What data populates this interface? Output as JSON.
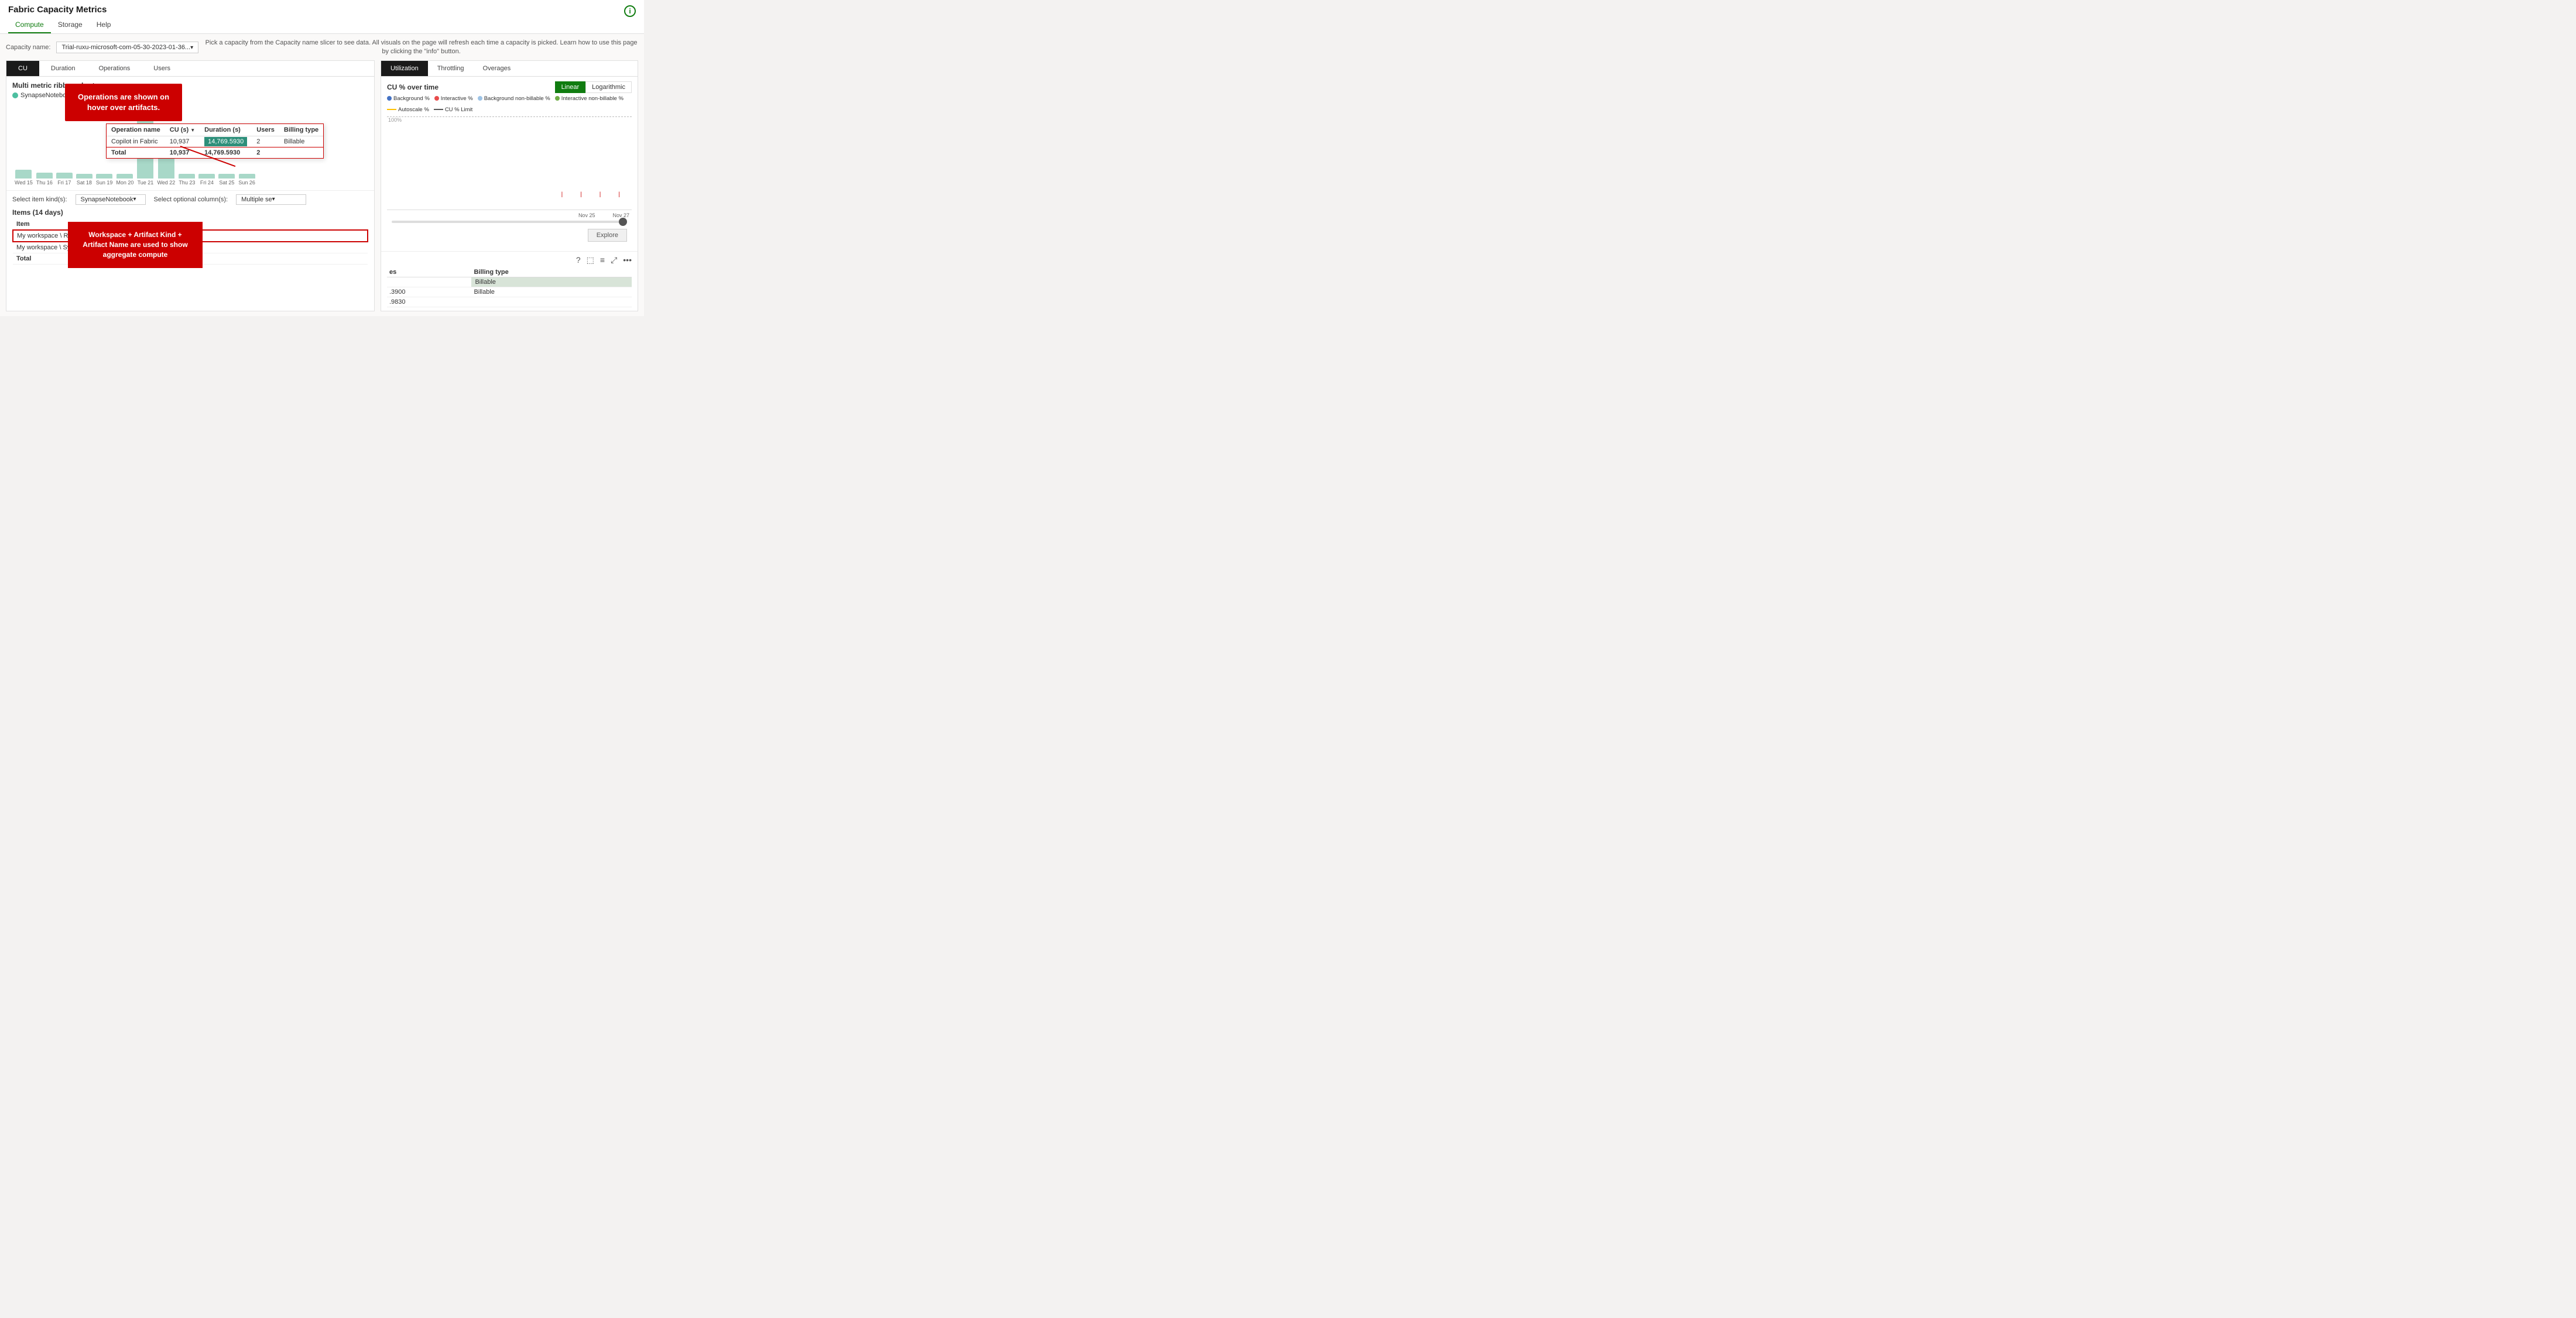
{
  "appTitle": "Fabric Capacity Metrics",
  "navTabs": [
    "Compute",
    "Storage",
    "Help"
  ],
  "activeNavTab": "Compute",
  "capacityLabel": "Capacity name:",
  "capacityValue": "Trial-ruxu-microsoft-com-05-30-2023-01-36...",
  "capacityHint": "Pick a capacity from the Capacity name slicer to see data. All visuals on the page will refresh each time a capacity is picked. Learn how to use this page by clicking the \"info\" button.",
  "metricTabs": [
    "CU",
    "Duration",
    "Operations",
    "Users"
  ],
  "activeMetricTab": "CU",
  "chartTitle": "Multi metric ribbon chart",
  "legendLabel": "SynapseNotebook",
  "legendColor": "#4dbfa0",
  "calloutText": "Operations are shown on hover over artifacts.",
  "barData": [
    {
      "label": "Wed 15",
      "height": 15
    },
    {
      "label": "Thu 16",
      "height": 10
    },
    {
      "label": "Fri 17",
      "height": 10
    },
    {
      "label": "Sat 18",
      "height": 8
    },
    {
      "label": "Sun 19",
      "height": 8
    },
    {
      "label": "Mon 20",
      "height": 8
    },
    {
      "label": "Tue 21",
      "height": 100
    },
    {
      "label": "Wed 22",
      "height": 70
    },
    {
      "label": "Thu 23",
      "height": 8
    },
    {
      "label": "Fri 24",
      "height": 8
    },
    {
      "label": "Sat 25",
      "height": 8
    },
    {
      "label": "Sun 26",
      "height": 8
    }
  ],
  "tooltipColumns": [
    "Operation name",
    "CU (s)",
    "Duration (s)",
    "Users",
    "Billing type"
  ],
  "tooltipRows": [
    {
      "name": "Copilot in Fabric",
      "cu": "10,937",
      "duration": "14,769.5930",
      "users": "2",
      "billing": "Billable"
    }
  ],
  "tooltipTotal": {
    "label": "Total",
    "cu": "10,937",
    "duration": "14,769.5930",
    "users": "2"
  },
  "itemsControls": {
    "kindLabel": "Select item kind(s):",
    "kindValue": "SynapseNotebook",
    "colLabel": "Select optional column(s):",
    "colValue": "Multiple se"
  },
  "itemsTitle": "Items (14 days)",
  "itemsColHeader": "Item",
  "tableRows": [
    {
      "item": "My workspace \\ Report \\ My First Report",
      "highlighted": true
    },
    {
      "item": "My workspace \\ SynapseNotebook \\ Notebook 9",
      "highlighted": false
    }
  ],
  "tableTotal": "Total",
  "bottomAnnotationText": "Workspace + Artifact Kind + Artifact Name are used to show aggregate compute",
  "utilTabs": [
    "Utilization",
    "Throttling",
    "Overages"
  ],
  "activeUtilTab": "Utilization",
  "utilChartTitle": "CU % over time",
  "scaleButtons": [
    "Linear",
    "Logarithmic"
  ],
  "activeScale": "Linear",
  "legendEntries": [
    {
      "label": "Background %",
      "color": "#4472c4",
      "type": "dot"
    },
    {
      "label": "Interactive %",
      "color": "#e84c4c",
      "type": "dot"
    },
    {
      "label": "Background non-billable %",
      "color": "#9dc3e6",
      "type": "dot"
    },
    {
      "label": "Interactive non-billable %",
      "color": "#70ad47",
      "type": "dot"
    },
    {
      "label": "Autoscale %",
      "color": "#ffc000",
      "type": "line"
    },
    {
      "label": "CU % Limit",
      "color": "#595959",
      "type": "line"
    }
  ],
  "hundredLabel": "100%",
  "timeAxisLabels": [
    "Nov 25",
    "Nov 27"
  ],
  "exploreBtn": "Explore",
  "rightIcons": [
    "?",
    "⬚",
    "≡",
    "⤢",
    "..."
  ],
  "rightTableCols": [
    "es",
    "Billing type"
  ],
  "rightTableRows": [
    {
      "es": "",
      "billing": "Billable"
    },
    {
      "es": "3900",
      "billing": "Billable"
    },
    {
      "es": "9830",
      "billing": ""
    }
  ]
}
